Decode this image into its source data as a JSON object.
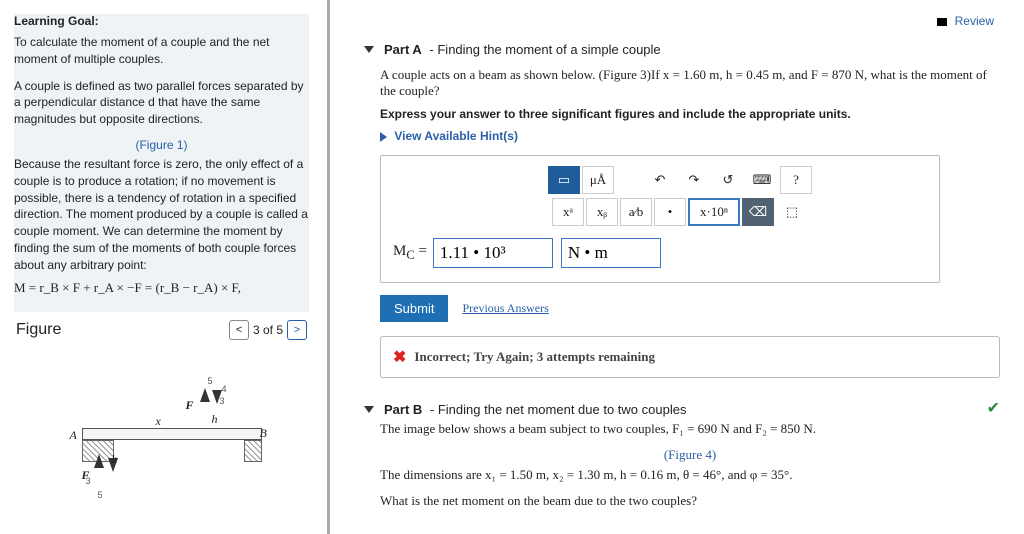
{
  "review": {
    "label": "Review"
  },
  "learning_goal": {
    "title": "Learning Goal:",
    "line1": "To calculate the moment of a couple and the net moment of multiple couples.",
    "line2": "A couple is defined as two parallel forces separated by a perpendicular distance d that have the same magnitudes but opposite directions.",
    "figure1_link": "(Figure 1)",
    "line3": "Because the resultant force is zero, the only effect of a couple is to produce a rotation; if no movement is possible, there is a tendency of rotation in a specified direction. The moment produced by a couple is called a couple moment. We can determine the moment by finding the sum of the moments of both couple forces about any arbitrary point:",
    "formula": "M = r_B × F + r_A × −F = (r_B − r_A) × F,"
  },
  "figure": {
    "section_title": "Figure",
    "page": "3 of 5",
    "labels": {
      "A": "A",
      "B": "B",
      "F": "F",
      "x": "x",
      "h": "h"
    }
  },
  "partA": {
    "header_bold": "Part A",
    "header_rest": " - Finding the moment of a simple couple",
    "question": "A couple acts on a beam as shown below. (Figure 3)If x = 1.60 m, h = 0.45 m, and F = 870 N, what is the moment of the couple?",
    "values": {
      "x": "1.60",
      "h": "0.45",
      "F": "870"
    },
    "instruction": "Express your answer to three significant figures and include the appropriate units.",
    "hints_label": "View Available Hint(s)",
    "toolbar": {
      "units": "μÅ",
      "undo": "↶",
      "redo": "↷",
      "reset": "↺",
      "keyboard": "⌨",
      "help": "?",
      "sup": "xᵃ",
      "sub": "xᵦ",
      "frac": "a⁄b",
      "dot": "•",
      "sci": "x·10ⁿ",
      "del": "⌫"
    },
    "eq_prefix": "M_C =",
    "answer_value": "1.11 • 10³",
    "answer_unit": "N • m",
    "submit": "Submit",
    "previous": "Previous Answers",
    "feedback": "Incorrect; Try Again; 3 attempts remaining"
  },
  "partB": {
    "header_bold": "Part B",
    "header_rest": " - Finding the net moment due to two couples",
    "line1": "The image below shows a beam subject to two couples, F₁ = 690 N and F₂ = 850 N.",
    "figure_link": "(Figure 4)",
    "line2": "The dimensions are x₁ = 1.50 m, x₂ = 1.30 m, h = 0.16 m, θ = 46°, and φ = 35°.",
    "line3": "What is the net moment on the beam due to the two couples?",
    "values": {
      "F1": "690",
      "F2": "850",
      "x1": "1.50",
      "x2": "1.30",
      "h": "0.16",
      "theta": "46",
      "phi": "35"
    }
  }
}
